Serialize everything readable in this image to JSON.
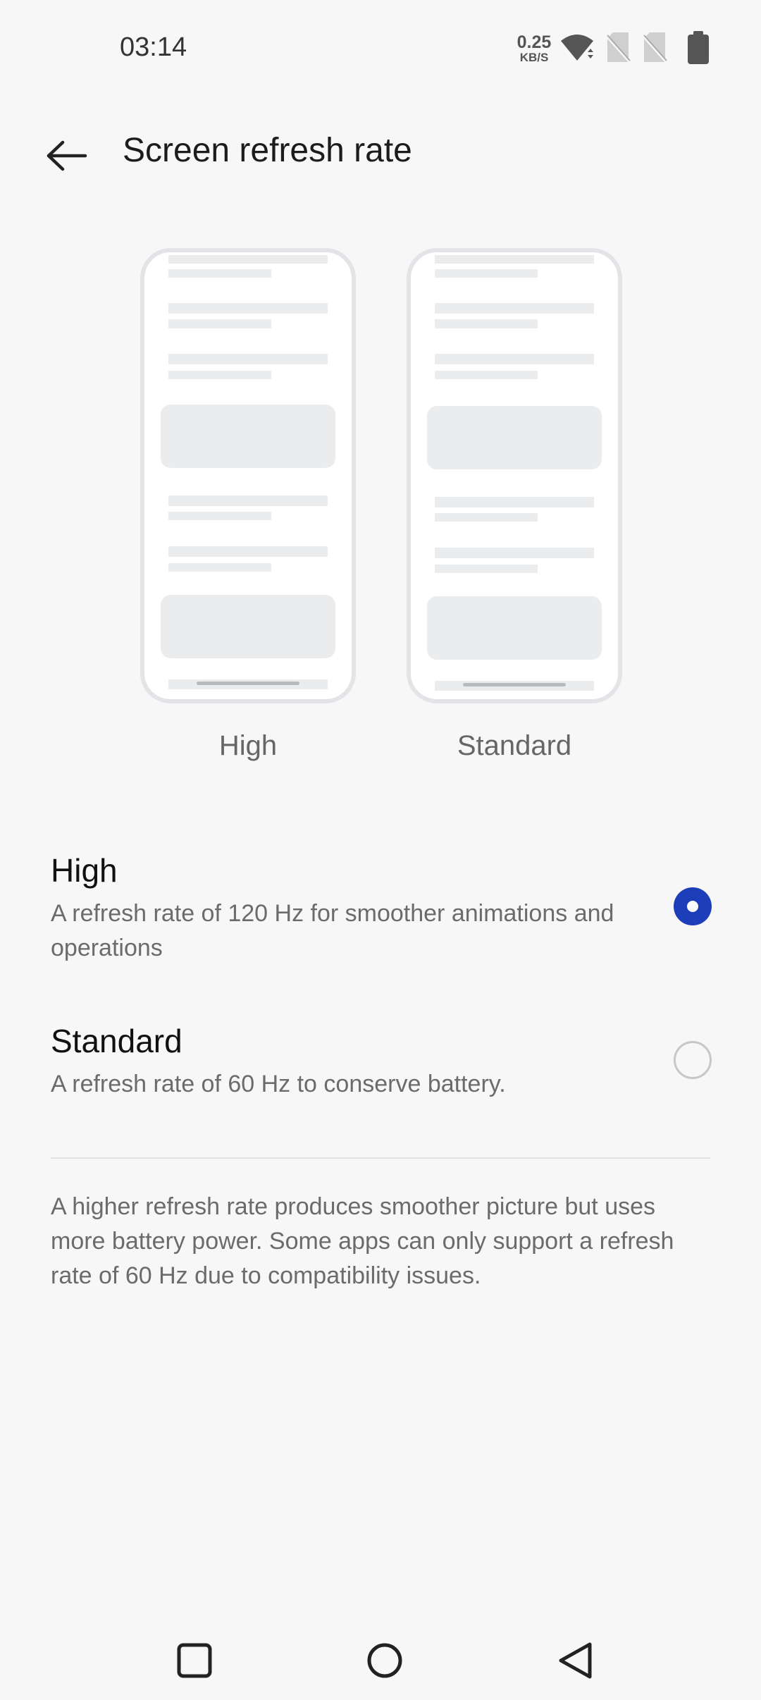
{
  "status_bar": {
    "time": "03:14",
    "net_speed_value": "0.25",
    "net_speed_unit": "KB/S",
    "icons": [
      "wifi-icon",
      "no-sim-icon",
      "no-sim-icon",
      "battery-icon"
    ]
  },
  "header": {
    "title": "Screen refresh rate",
    "back_icon": "arrow-left-icon"
  },
  "previews": [
    {
      "label": "High"
    },
    {
      "label": "Standard"
    }
  ],
  "options": [
    {
      "title": "High",
      "description": "A refresh rate of 120 Hz for smoother animations and operations",
      "selected": true
    },
    {
      "title": "Standard",
      "description": "A refresh rate of 60 Hz to conserve battery.",
      "selected": false
    }
  ],
  "footer_note": "A higher refresh rate produces smoother picture but uses more battery power. Some apps can only support a refresh rate of 60 Hz due to compatibility issues.",
  "nav_bar": {
    "icons": [
      "recents-square-icon",
      "home-circle-icon",
      "back-triangle-icon"
    ]
  },
  "colors": {
    "accent": "#1c3eb8",
    "background": "#f7f7f8",
    "preview_outline": "#e3e4e8",
    "preview_fill": "#ebecee"
  }
}
